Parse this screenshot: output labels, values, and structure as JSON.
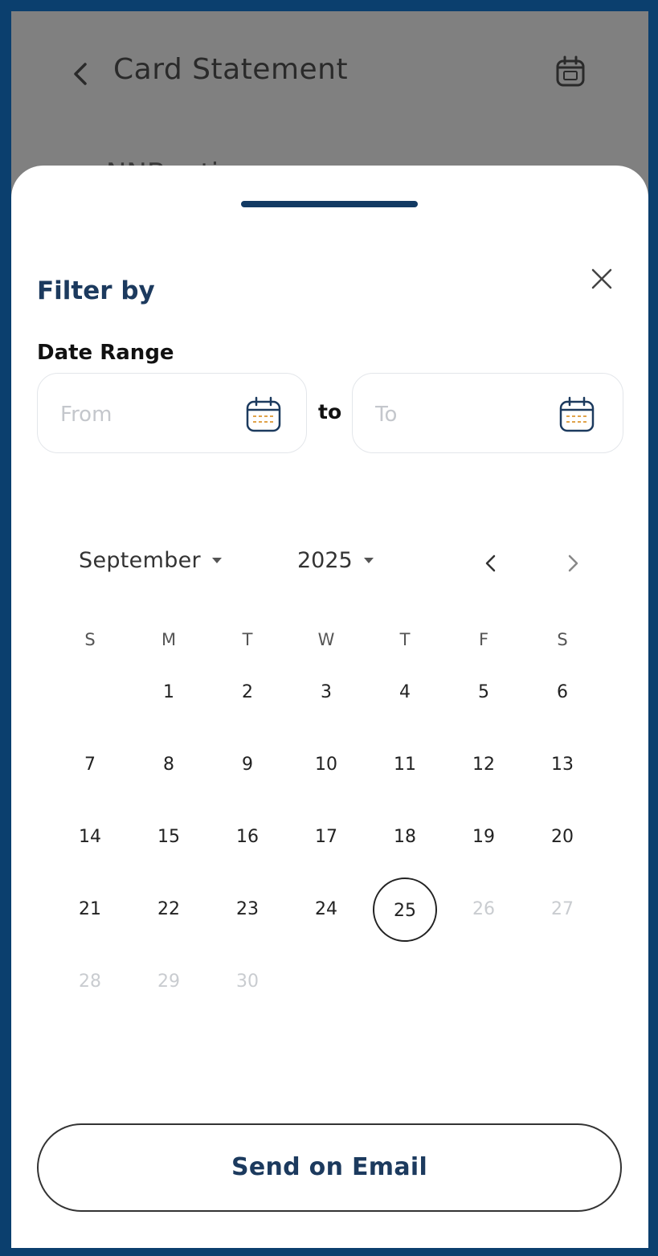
{
  "app_bar": {
    "title": "Card Statement",
    "peek_text": "NNB   ...ti"
  },
  "sheet": {
    "title": "Filter by",
    "close_icon": "close-icon",
    "date_range": {
      "label": "Date Range",
      "from_placeholder": "From",
      "to_placeholder": "To",
      "separator": "to"
    },
    "calendar": {
      "month": "September",
      "year": "2025",
      "weekdays": [
        "S",
        "M",
        "T",
        "W",
        "T",
        "F",
        "S"
      ],
      "days": [
        [
          "",
          "1",
          "2",
          "3",
          "4",
          "5",
          "6"
        ],
        [
          "7",
          "8",
          "9",
          "10",
          "11",
          "12",
          "13"
        ],
        [
          "14",
          "15",
          "16",
          "17",
          "18",
          "19",
          "20"
        ],
        [
          "21",
          "22",
          "23",
          "24",
          "25",
          "26",
          "27"
        ],
        [
          "28",
          "29",
          "30",
          "",
          "",
          "",
          ""
        ]
      ],
      "today": "25",
      "disabled_days": [
        "26",
        "27",
        "28",
        "29",
        "30"
      ]
    },
    "send_button_label": "Send on Email"
  },
  "colors": {
    "frame": "#0b3f6e",
    "accent": "#1c3a5e",
    "overlay": "#808080"
  }
}
